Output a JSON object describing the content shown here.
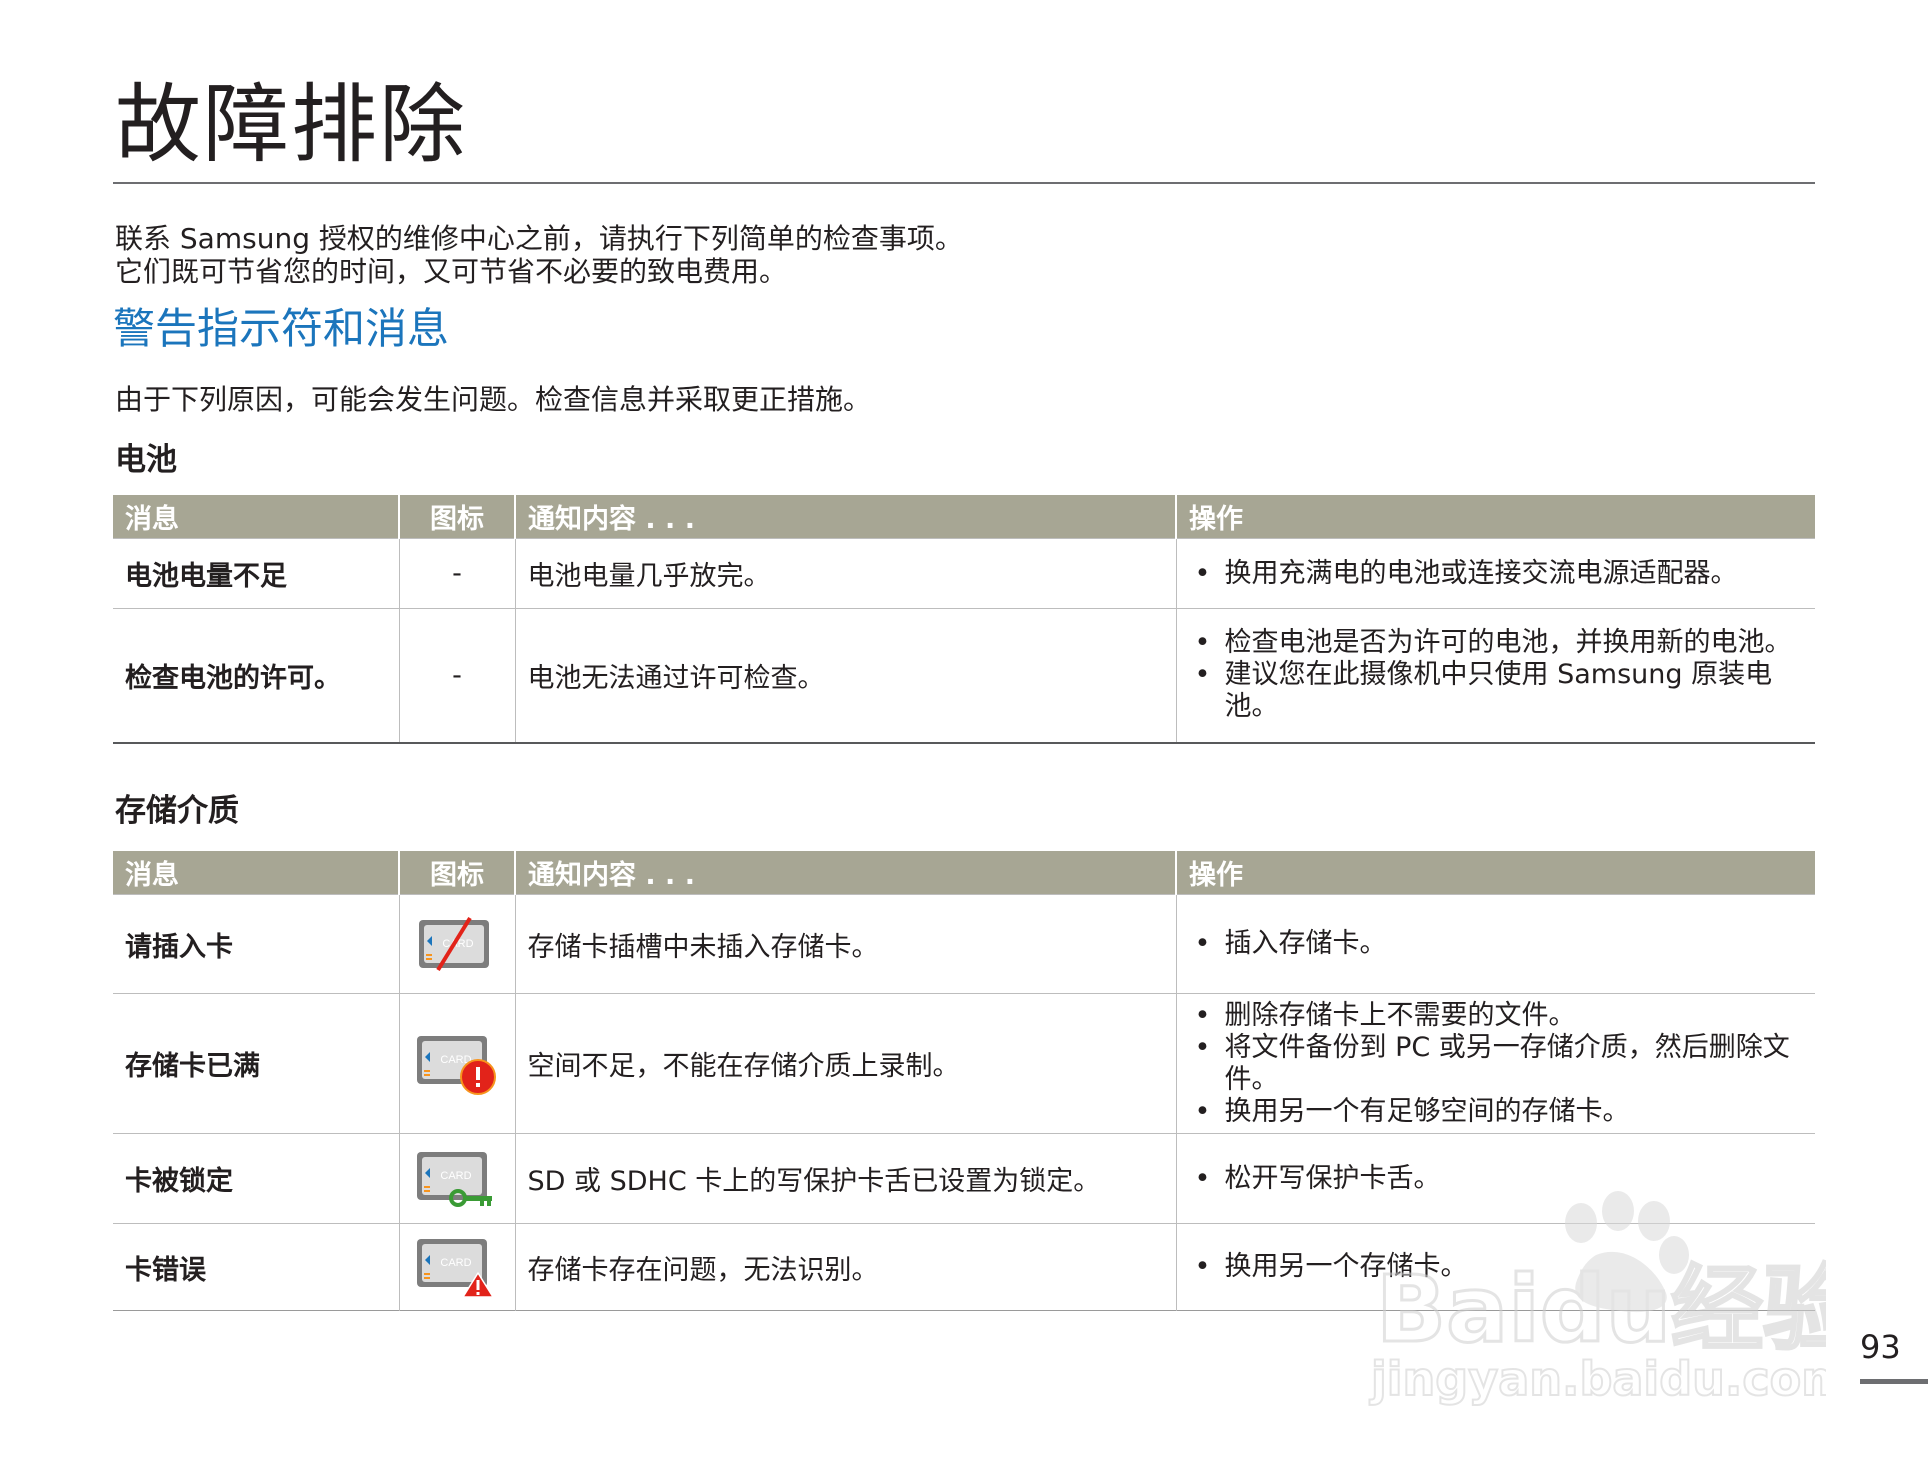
{
  "page": {
    "title": "故障排除",
    "intro_lines": [
      "联系 Samsung 授权的维修中心之前，请执行下列简单的检查事项。",
      "它们既可节省您的时间，又可节省不必要的致电费用。"
    ],
    "section_heading": "警告指示符和消息",
    "section_desc": "由于下列原因，可能会发生问题。检查信息并采取更正措施。",
    "page_number": "93"
  },
  "table_headers": {
    "message": "消息",
    "icon": "图标",
    "notice": "通知内容 . . .",
    "action": "操作"
  },
  "battery": {
    "title": "电池",
    "rows": [
      {
        "message": "电池电量不足",
        "icon": "-",
        "notice": "电池电量几乎放完。",
        "actions": [
          "换用充满电的电池或连接交流电源适配器。"
        ]
      },
      {
        "message": "检查电池的许可。",
        "icon": "-",
        "notice": "电池无法通过许可检查。",
        "actions": [
          "检查电池是否为许可的电池，并换用新的电池。",
          "建议您在此摄像机中只使用 Samsung 原装电池。"
        ]
      }
    ]
  },
  "media": {
    "title": "存储介质",
    "rows": [
      {
        "message": "请插入卡",
        "icon": "card-crossed-icon",
        "notice": "存储卡插槽中未插入存储卡。",
        "actions": [
          "插入存储卡。"
        ]
      },
      {
        "message": "存储卡已满",
        "icon": "card-full-icon",
        "notice": "空间不足，不能在存储介质上录制。",
        "actions": [
          "删除存储卡上不需要的文件。",
          "将文件备份到 PC 或另一存储介质，然后删除文件。",
          "换用另一个有足够空间的存储卡。"
        ]
      },
      {
        "message": "卡被锁定",
        "icon": "card-locked-icon",
        "notice": "SD 或 SDHC 卡上的写保护卡舌已设置为锁定。",
        "actions": [
          "松开写保护卡舌。"
        ]
      },
      {
        "message": "卡错误",
        "icon": "card-error-icon",
        "notice": "存储卡存在问题，无法识别。",
        "actions": [
          "换用另一个存储卡。"
        ]
      }
    ]
  },
  "card_icon_text": "CARD",
  "watermark": {
    "brand": "Baidu经验",
    "url": "jingyan.baidu.com"
  },
  "colors": {
    "header_bg": "#a7a694",
    "heading_blue": "#1b75bc",
    "text": "#231f20",
    "alert_red": "#e2231a",
    "lock_green": "#3a9b35"
  }
}
